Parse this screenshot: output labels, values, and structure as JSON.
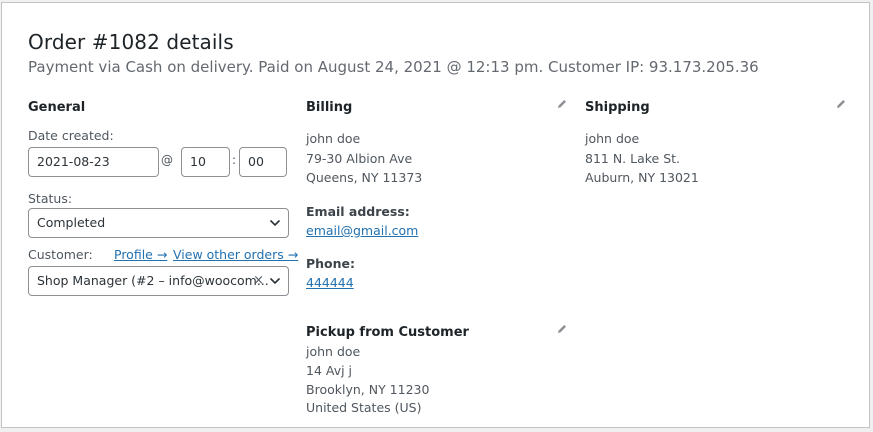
{
  "header": {
    "title": "Order #1082 details",
    "subtitle": "Payment via Cash on delivery. Paid on August 24, 2021 @ 12:13 pm. Customer IP: 93.173.205.36"
  },
  "general": {
    "heading": "General",
    "date_label": "Date created:",
    "date_value": "2021-08-23",
    "at_symbol": "@",
    "hour_value": "10",
    "colon": ":",
    "minute_value": "00",
    "status_label": "Status:",
    "status_value": "Completed",
    "customer_label": "Customer:",
    "profile_link": "Profile →",
    "other_orders_link": "View other orders →",
    "customer_value": "Shop Manager (#2 – info@woocom...",
    "clear_symbol": "×"
  },
  "billing": {
    "heading": "Billing",
    "lines": [
      "john doe",
      "79-30 Albion Ave",
      "Queens, NY 11373"
    ],
    "email_label": "Email address:",
    "email": "email@gmail.com",
    "phone_label": "Phone:",
    "phone": "444444"
  },
  "pickup": {
    "heading": "Pickup from Customer",
    "lines": [
      "john doe",
      "14 Avj j",
      "Brooklyn, NY 11230",
      "United States (US)"
    ]
  },
  "shipping": {
    "heading": "Shipping",
    "lines": [
      "john doe",
      "811 N. Lake St.",
      "Auburn, NY 13021"
    ]
  }
}
